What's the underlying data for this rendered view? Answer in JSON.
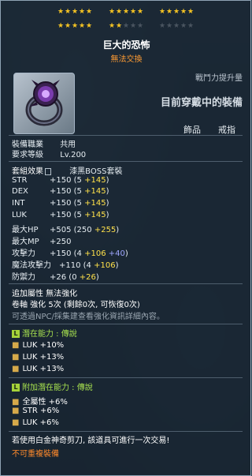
{
  "stars": {
    "filled_count": 17,
    "total_count": 25
  },
  "item": {
    "name": "巨大的恐怖",
    "trade_status": "無法交換",
    "upgrade_label": "戰鬥力提升量",
    "equipped_text": "目前穿戴中的裝備",
    "category": "飾品",
    "sub_category": "戒指",
    "equip_job_label": "裝備職業",
    "equip_job_value": "共用",
    "req_level_label": "要求等級",
    "req_level_value": "Lv.200",
    "set_label": "套組效果",
    "set_value": "漆黑BOSS套裝"
  },
  "stats": [
    {
      "name": "STR",
      "total": "+150",
      "base": "(5 ",
      "bonus": "+145",
      "close": ")"
    },
    {
      "name": "DEX",
      "total": "+150",
      "base": "(5 ",
      "bonus": "+145",
      "close": ")"
    },
    {
      "name": "INT",
      "total": "+150",
      "base": "(5 ",
      "bonus": "+145",
      "close": ")"
    },
    {
      "name": "LUK",
      "total": "+150",
      "base": "(5 ",
      "bonus": "+145",
      "close": ")"
    },
    {
      "name": "最大HP",
      "total": "+505",
      "base": "(250 ",
      "bonus": "+255",
      "close": ")"
    },
    {
      "name": "最大MP",
      "total": "+250",
      "base": "",
      "bonus": "",
      "close": ""
    },
    {
      "name": "攻擊力",
      "total": "+150",
      "base": "(4 ",
      "bonus": "+106 ",
      "extra": "+40",
      "close": ")"
    },
    {
      "name": "魔法攻擊力",
      "total": "+110",
      "base": "(4 ",
      "bonus": "+106",
      "close": ")"
    },
    {
      "name": "防禦力",
      "total": "+26",
      "base": "(0 ",
      "bonus": "+26",
      "close": ")"
    }
  ],
  "extra": {
    "additional": "追加屬性 無法強化",
    "scroll": "卷軸 強化 5次 (剩餘0次, 可恢復0次)",
    "npc_hint": "可透過NPC/採集建查看強化資訊詳細內容。"
  },
  "potential": {
    "badge": "L",
    "title": "潛在能力 : 傳說",
    "lines": [
      "LUK +10%",
      "LUK +13%",
      "LUK +13%"
    ]
  },
  "bonus_potential": {
    "badge": "L",
    "title": "附加潛在能力 : 傳說",
    "lines": [
      "全屬性 +6%",
      "STR +6%",
      "LUK +6%"
    ]
  },
  "footer": {
    "scissors": "若使用白金神奇剪刀, 該道具可進行一次交易!",
    "no_duplicate": "不可重複裝備"
  },
  "colors": {
    "star_on": "#f6c423",
    "bonus_yellow": "#ffe14a",
    "potential_green": "#a6e04f",
    "warning_orange": "#ff8a2b"
  }
}
